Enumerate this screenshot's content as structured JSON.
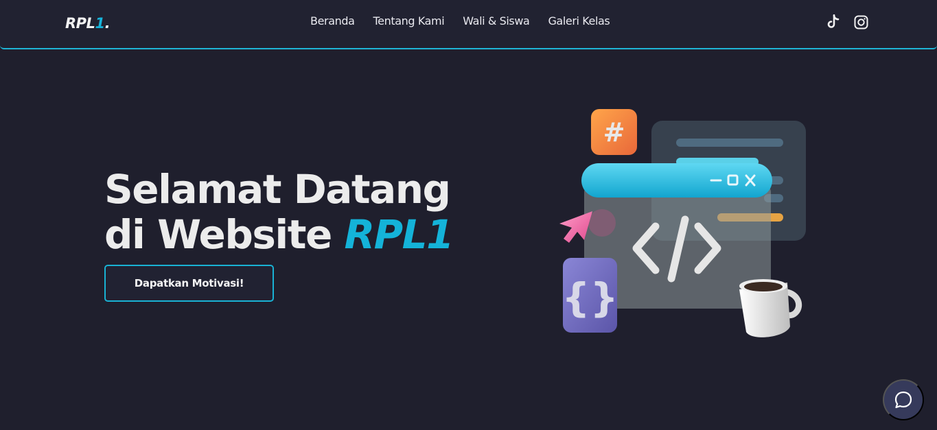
{
  "brand": {
    "name": "RPL",
    "accent": "1",
    "dot": "."
  },
  "nav": {
    "items": [
      {
        "label": "Beranda"
      },
      {
        "label": "Tentang Kami"
      },
      {
        "label": "Wali & Siswa"
      },
      {
        "label": "Galeri Kelas"
      }
    ]
  },
  "social": {
    "tiktok_icon": "tiktok-icon",
    "instagram_icon": "instagram-icon"
  },
  "hero": {
    "title_line1": "Selamat Datang",
    "title_line2_prefix": "di Website ",
    "title_line2_accent": "RPL1",
    "cta_label": "Dapatkan Motivasi!"
  },
  "illustration": {
    "hash_symbol": "#",
    "braces_symbol": "{}",
    "code_symbol": "</>"
  },
  "chat": {
    "icon": "chat-bubble-icon"
  },
  "colors": {
    "background": "#1f1f2d",
    "navbar": "#212231",
    "accent": "#16b4db",
    "text": "#ececec"
  }
}
